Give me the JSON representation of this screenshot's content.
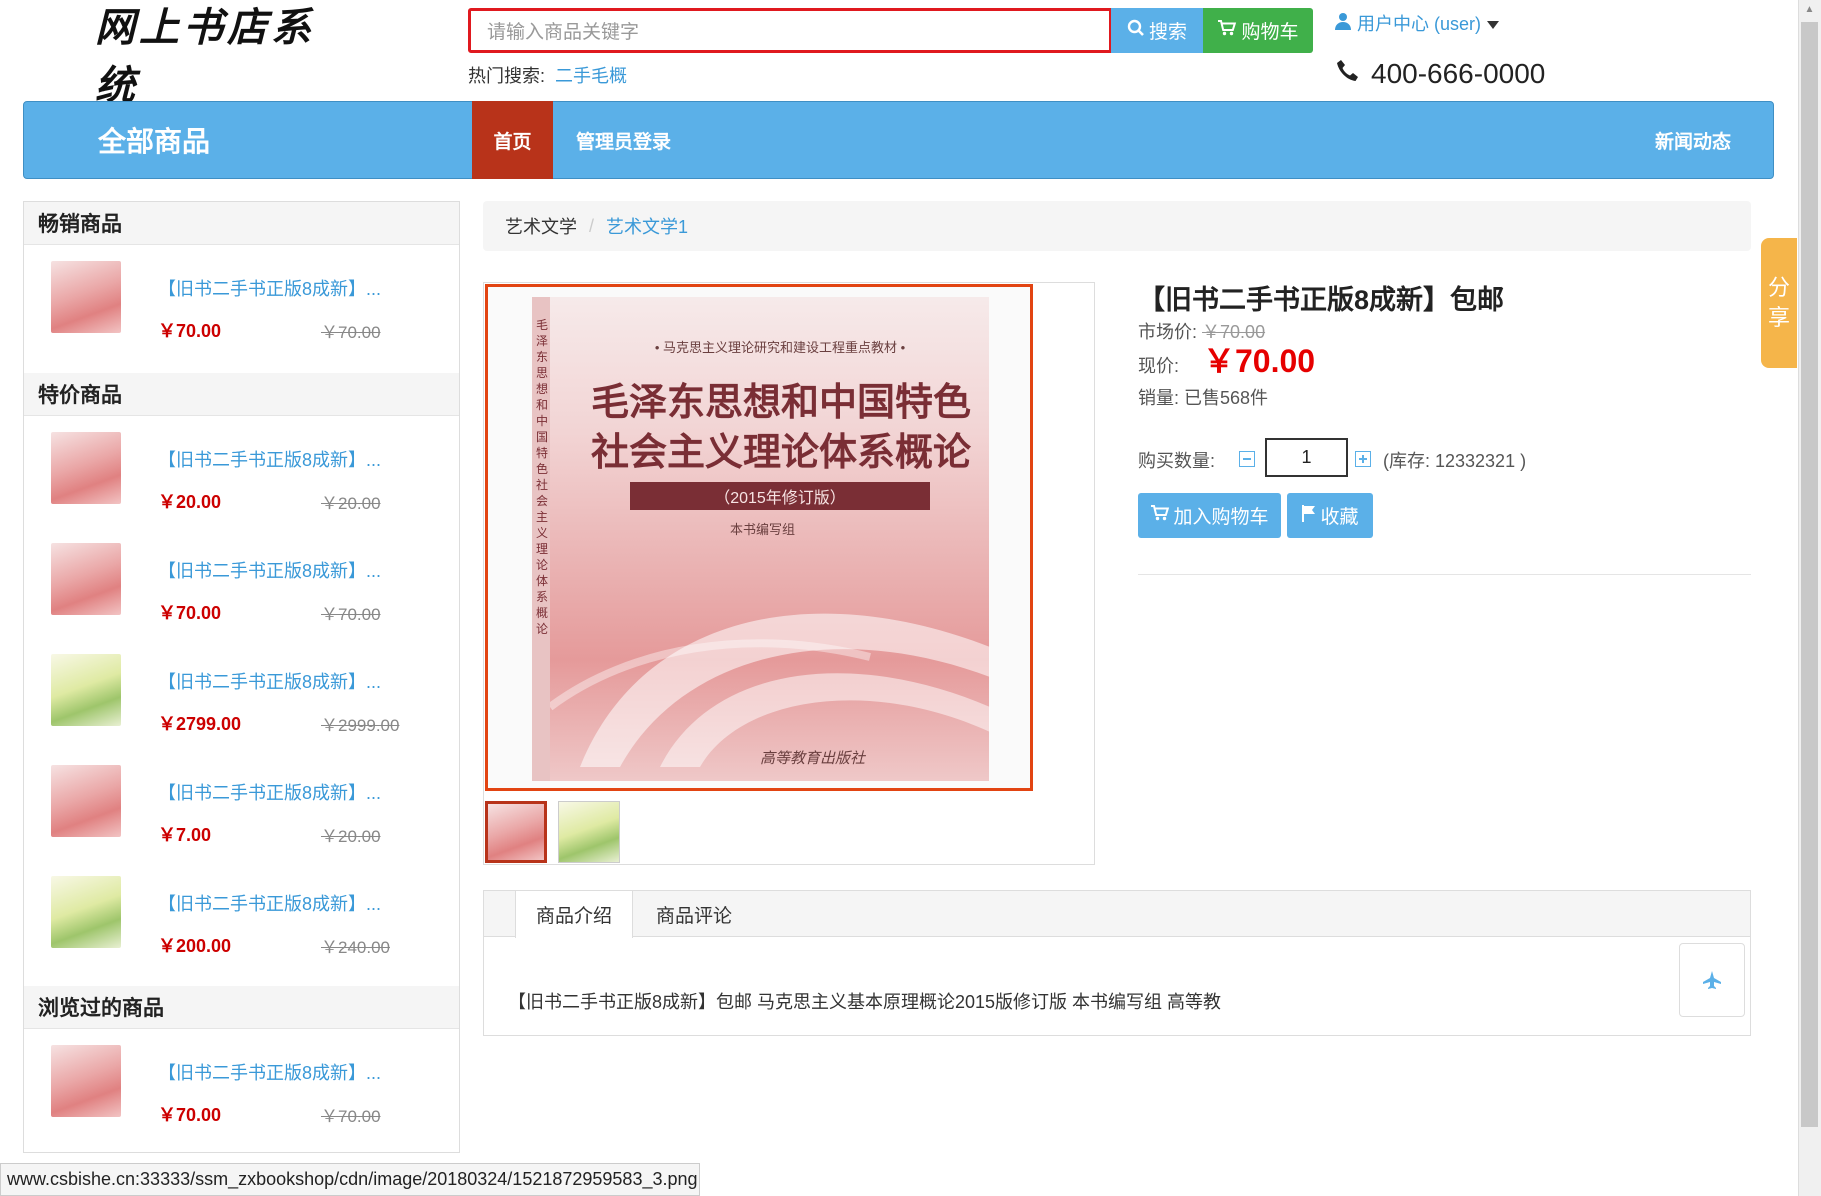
{
  "header": {
    "logo_text": "网上书店系统",
    "search_placeholder": "请输入商品关键字",
    "search_button": "搜索",
    "cart_button": "购物车",
    "hot_label": "热门搜索:",
    "hot_link": "二手毛概",
    "user_center": "用户中心 (user)",
    "phone": "400-666-0000"
  },
  "nav": {
    "all_goods": "全部商品",
    "home": "首页",
    "admin_login": "管理员登录",
    "news": "新闻动态"
  },
  "sidebar": {
    "sections": [
      {
        "title": "畅销商品",
        "items": [
          {
            "title": "【旧书二手书正版8成新】...",
            "price": "￥70.00",
            "old_price": "￥70.00",
            "thumb": "red"
          }
        ]
      },
      {
        "title": "特价商品",
        "items": [
          {
            "title": "【旧书二手书正版8成新】...",
            "price": "￥20.00",
            "old_price": "￥20.00",
            "thumb": "red"
          },
          {
            "title": "【旧书二手书正版8成新】...",
            "price": "￥70.00",
            "old_price": "￥70.00",
            "thumb": "red"
          },
          {
            "title": "【旧书二手书正版8成新】...",
            "price": "￥2799.00",
            "old_price": "￥2999.00",
            "thumb": "green"
          },
          {
            "title": "【旧书二手书正版8成新】...",
            "price": "￥7.00",
            "old_price": "￥20.00",
            "thumb": "red"
          },
          {
            "title": "【旧书二手书正版8成新】...",
            "price": "￥200.00",
            "old_price": "￥240.00",
            "thumb": "green"
          }
        ]
      },
      {
        "title": "浏览过的商品",
        "items": [
          {
            "title": "【旧书二手书正版8成新】...",
            "price": "￥70.00",
            "old_price": "￥70.00",
            "thumb": "red"
          }
        ]
      }
    ]
  },
  "breadcrumb": {
    "parent": "艺术文学",
    "separator": "/",
    "current": "艺术文学1"
  },
  "book_cover": {
    "series": "• 马克思主义理论研究和建设工程重点教材 •",
    "title_line1": "毛泽东思想和中国特色",
    "title_line2": "社会主义理论体系概论",
    "edition": "（2015年修订版）",
    "author": "本书编写组",
    "publisher": "高等教育出版社",
    "spine": "毛泽东思想和中国特色社会主义理论体系概论"
  },
  "product": {
    "title": "【旧书二手书正版8成新】包邮",
    "market_label": "市场价:",
    "market_price": "￥70.00",
    "now_label": "现价:",
    "now_price": "￥70.00",
    "sales": "销量: 已售568件",
    "qty_label": "购买数量:",
    "qty_value": "1",
    "stock": "(库存: 12332321 )",
    "add_to_cart": "加入购物车",
    "favorite": "收藏"
  },
  "tabs": {
    "intro": "商品介绍",
    "review": "商品评论",
    "content": "【旧书二手书正版8成新】包邮 马克思主义基本原理概论2015版修订版 本书编写组 高等教"
  },
  "share": "分享",
  "status_url": "www.csbishe.cn:33333/ssm_zxbookshop/cdn/image/20180324/1521872959583_3.png",
  "colors": {
    "primary": "#5bb0e8",
    "accent": "#b8331a",
    "price": "#e60000",
    "cart": "#40b04a",
    "share": "#f5b54a"
  }
}
